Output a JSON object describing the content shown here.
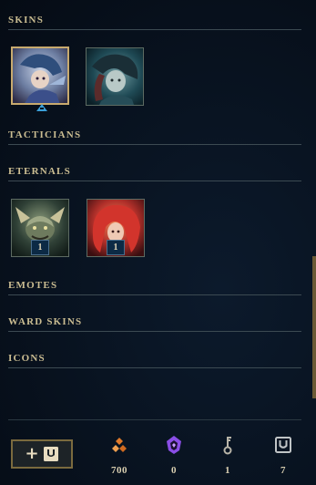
{
  "sections": {
    "skins": {
      "label": "SKINS"
    },
    "tacticians": {
      "label": "TACTICIANS"
    },
    "eternals": {
      "label": "ETERNALS"
    },
    "emotes": {
      "label": "EMOTES"
    },
    "ward_skins": {
      "label": "WARD SKINS"
    },
    "icons": {
      "label": "ICONS"
    }
  },
  "skins": [
    {
      "name": "skin-1",
      "selected": true
    },
    {
      "name": "skin-2",
      "selected": false
    }
  ],
  "eternals": [
    {
      "count": "1"
    },
    {
      "count": "1"
    }
  ],
  "footer": {
    "add_button": {
      "icon": "plus-loot-icon"
    },
    "currencies": [
      {
        "icon": "orange-essence-icon",
        "value": "700",
        "color": "#e07a2a"
      },
      {
        "icon": "mythic-essence-icon",
        "value": "0",
        "color": "#a064ff"
      },
      {
        "icon": "key-icon",
        "value": "1",
        "color": "#b9b5a8"
      },
      {
        "icon": "chest-icon",
        "value": "7",
        "color": "#c0c4c6"
      }
    ]
  },
  "colors": {
    "accent_gold": "#c8aa6e",
    "background": "#08121f",
    "owned_indicator": "#3aa0d9"
  }
}
